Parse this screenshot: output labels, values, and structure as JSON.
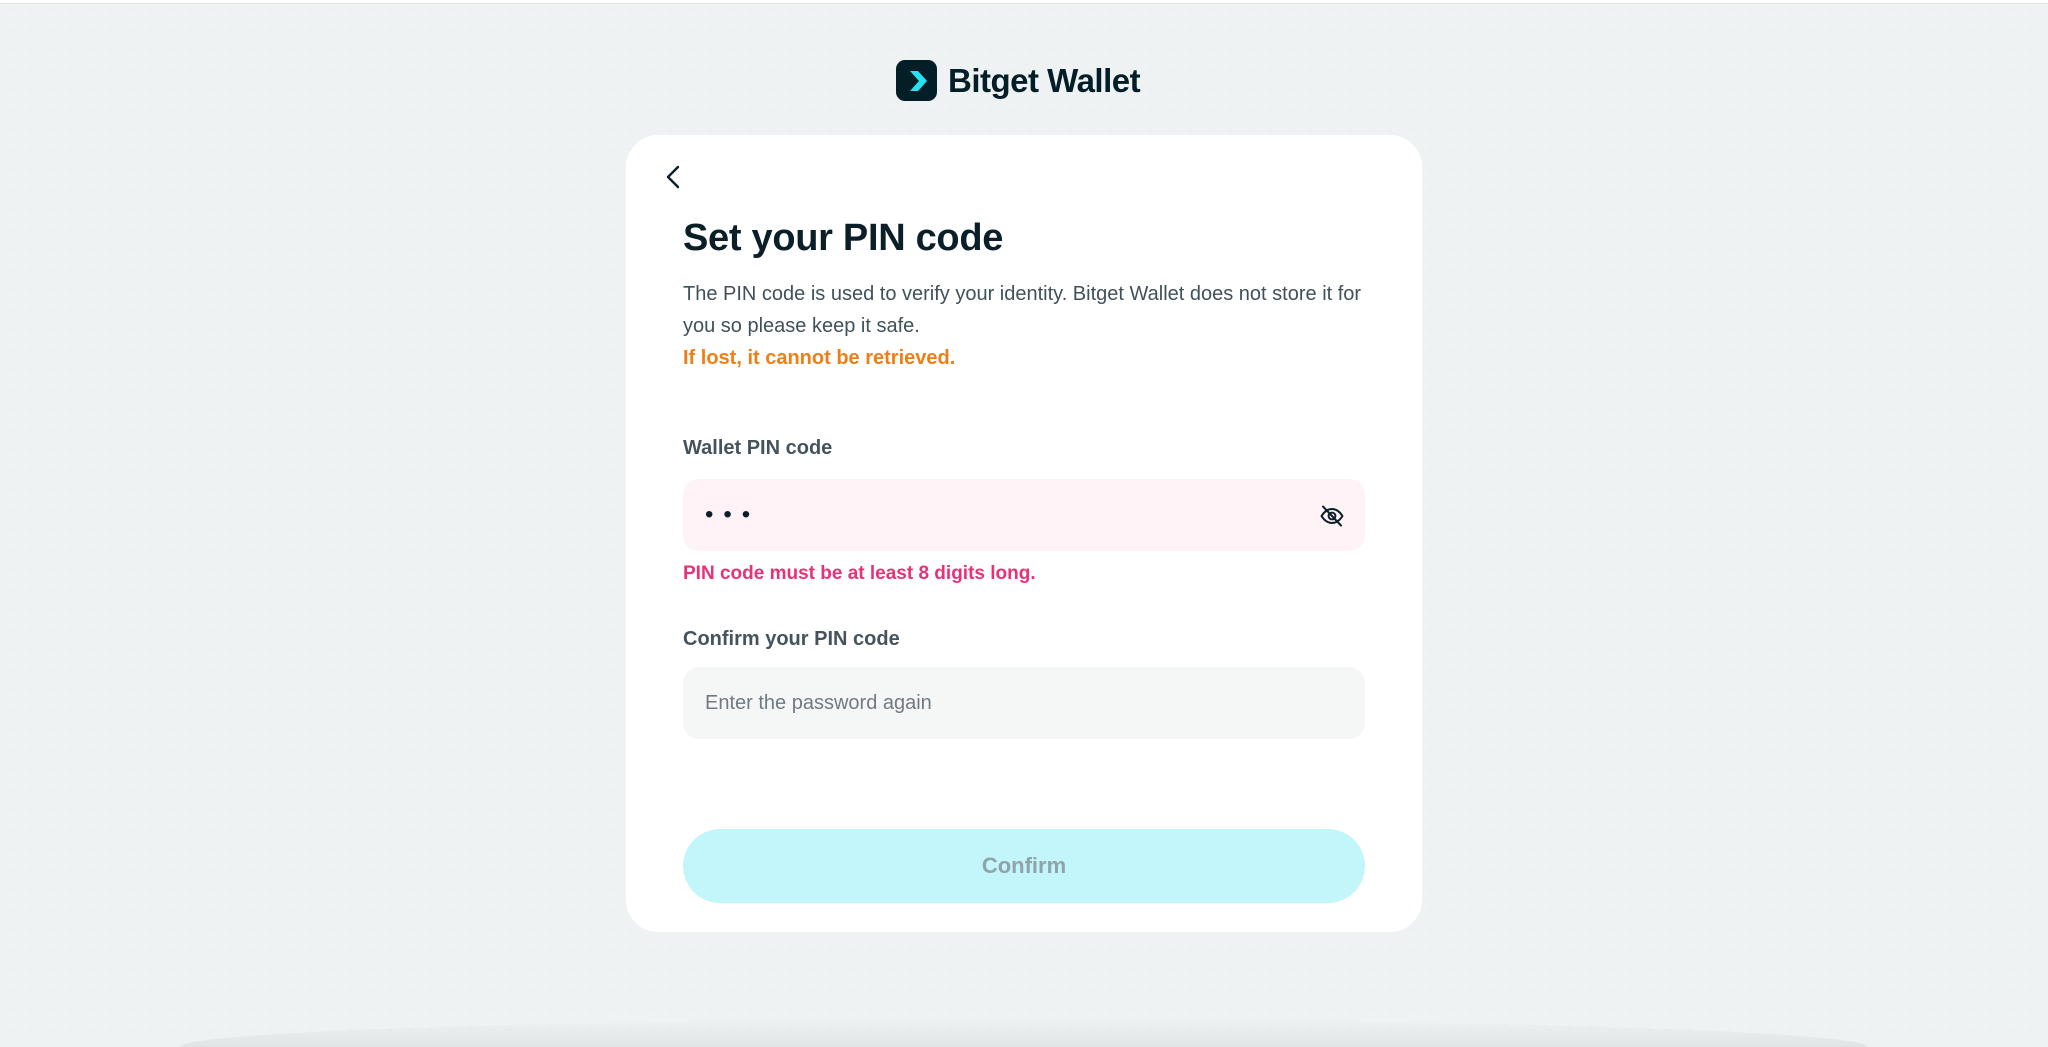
{
  "brand": {
    "name": "Bitget Wallet",
    "mark_bg": "#041e28",
    "mark_accent": "#22e3ef"
  },
  "page": {
    "title": "Set your PIN code",
    "description": "The PIN code is used to verify your identity. Bitget Wallet does not store it for you so please keep it safe.",
    "warning": "If lost, it cannot be retrieved.",
    "back_icon": "chevron-left-icon"
  },
  "pin_field": {
    "label": "Wallet PIN code",
    "value": "•••",
    "error": "PIN code must be at least 8 digits long.",
    "toggle_icon": "eye-off-icon"
  },
  "confirm_field": {
    "label": "Confirm your PIN code",
    "value": "",
    "placeholder": "Enter the password again"
  },
  "actions": {
    "confirm_label": "Confirm"
  },
  "colors": {
    "warning": "#ee7f16",
    "error": "#e9317a",
    "button_disabled_bg": "#c3f6fa",
    "error_field_bg": "#fff3f7"
  }
}
